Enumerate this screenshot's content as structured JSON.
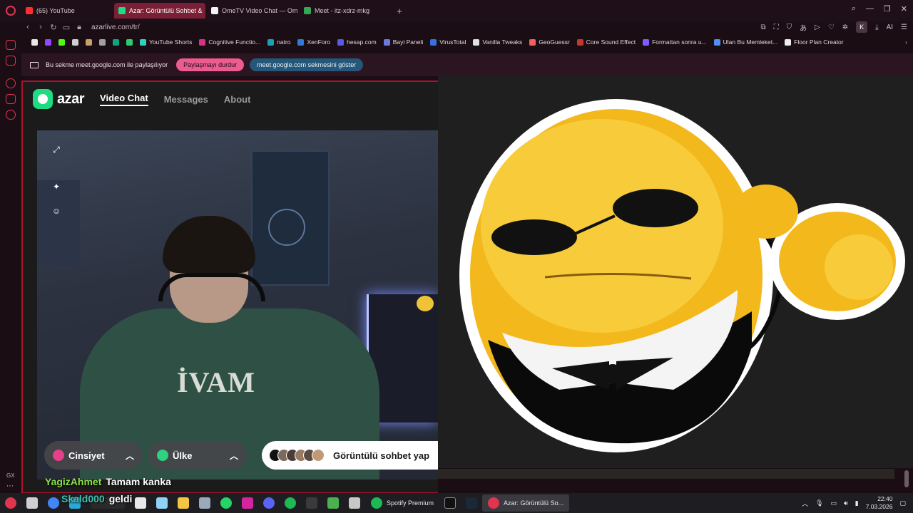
{
  "browser": {
    "tabs": [
      {
        "label": "(65) YouTube",
        "color": "#ff2d2d"
      },
      {
        "label": "Azar: Görüntülü Sohbet &",
        "color": "#1fdc82"
      },
      {
        "label": "OmeTV Video Chat — Om",
        "color": "#ffffff"
      },
      {
        "label": "Meet - itz-xdrz-mkg",
        "color": "#34a853"
      }
    ],
    "new_tab": "+",
    "url": "azarlive.com/tr/",
    "profile_letter": "K",
    "ai_label": "AI",
    "bookmarks": [
      {
        "label": "YouTube Shorts",
        "color": "#2dd3c1"
      },
      {
        "label": "Cognitive Functio...",
        "color": "#d63384"
      },
      {
        "label": "natro",
        "color": "#17a2b8"
      },
      {
        "label": "XenForo",
        "color": "#2f7bd8"
      },
      {
        "label": "hesap.com",
        "color": "#5a5ae6"
      },
      {
        "label": "Bayi Paneli",
        "color": "#6c7ae0"
      },
      {
        "label": "VirusTotal",
        "color": "#3b6fe0"
      },
      {
        "label": "Vanilla Tweaks",
        "color": "#e0e0e0"
      },
      {
        "label": "GeoGuessr",
        "color": "#f25f5c"
      },
      {
        "label": "Core Sound Effect",
        "color": "#c0392b"
      },
      {
        "label": "Formattan sonra u...",
        "color": "#7d5fff"
      },
      {
        "label": "Ulan Bu Memleket...",
        "color": "#4f8ef7"
      },
      {
        "label": "Floor Plan Creator",
        "color": "#eeeeee"
      }
    ]
  },
  "share_bar": {
    "text": "Bu sekme meet.google.com ile paylaşılıyor",
    "stop_label": "Paylaşmayı durdur",
    "show_label": "meet.google.com sekmesini göster"
  },
  "azar": {
    "logo_text": "azar",
    "nav": [
      "Video Chat",
      "Messages",
      "About"
    ],
    "camera_text": "İVAM",
    "gender_filter": "Cinsiyet",
    "country_filter": "Ülke",
    "start_label": "Görüntülü sohbet yap"
  },
  "chat": [
    {
      "name": "YagizAhmet",
      "message": "Tamam kanka"
    },
    {
      "name": "Skald000",
      "message": "geldi"
    }
  ],
  "taskbar": {
    "apps": [
      "Spotify Premium",
      "Azar: Görüntülü So..."
    ],
    "time": "22:40",
    "date": "7.03.2026"
  },
  "sidebar": {
    "gx_label": "GX"
  },
  "colors": {
    "accent": "#b3112b",
    "azar_green": "#1fdc82",
    "emoji_yellow": "#f3b81c"
  }
}
